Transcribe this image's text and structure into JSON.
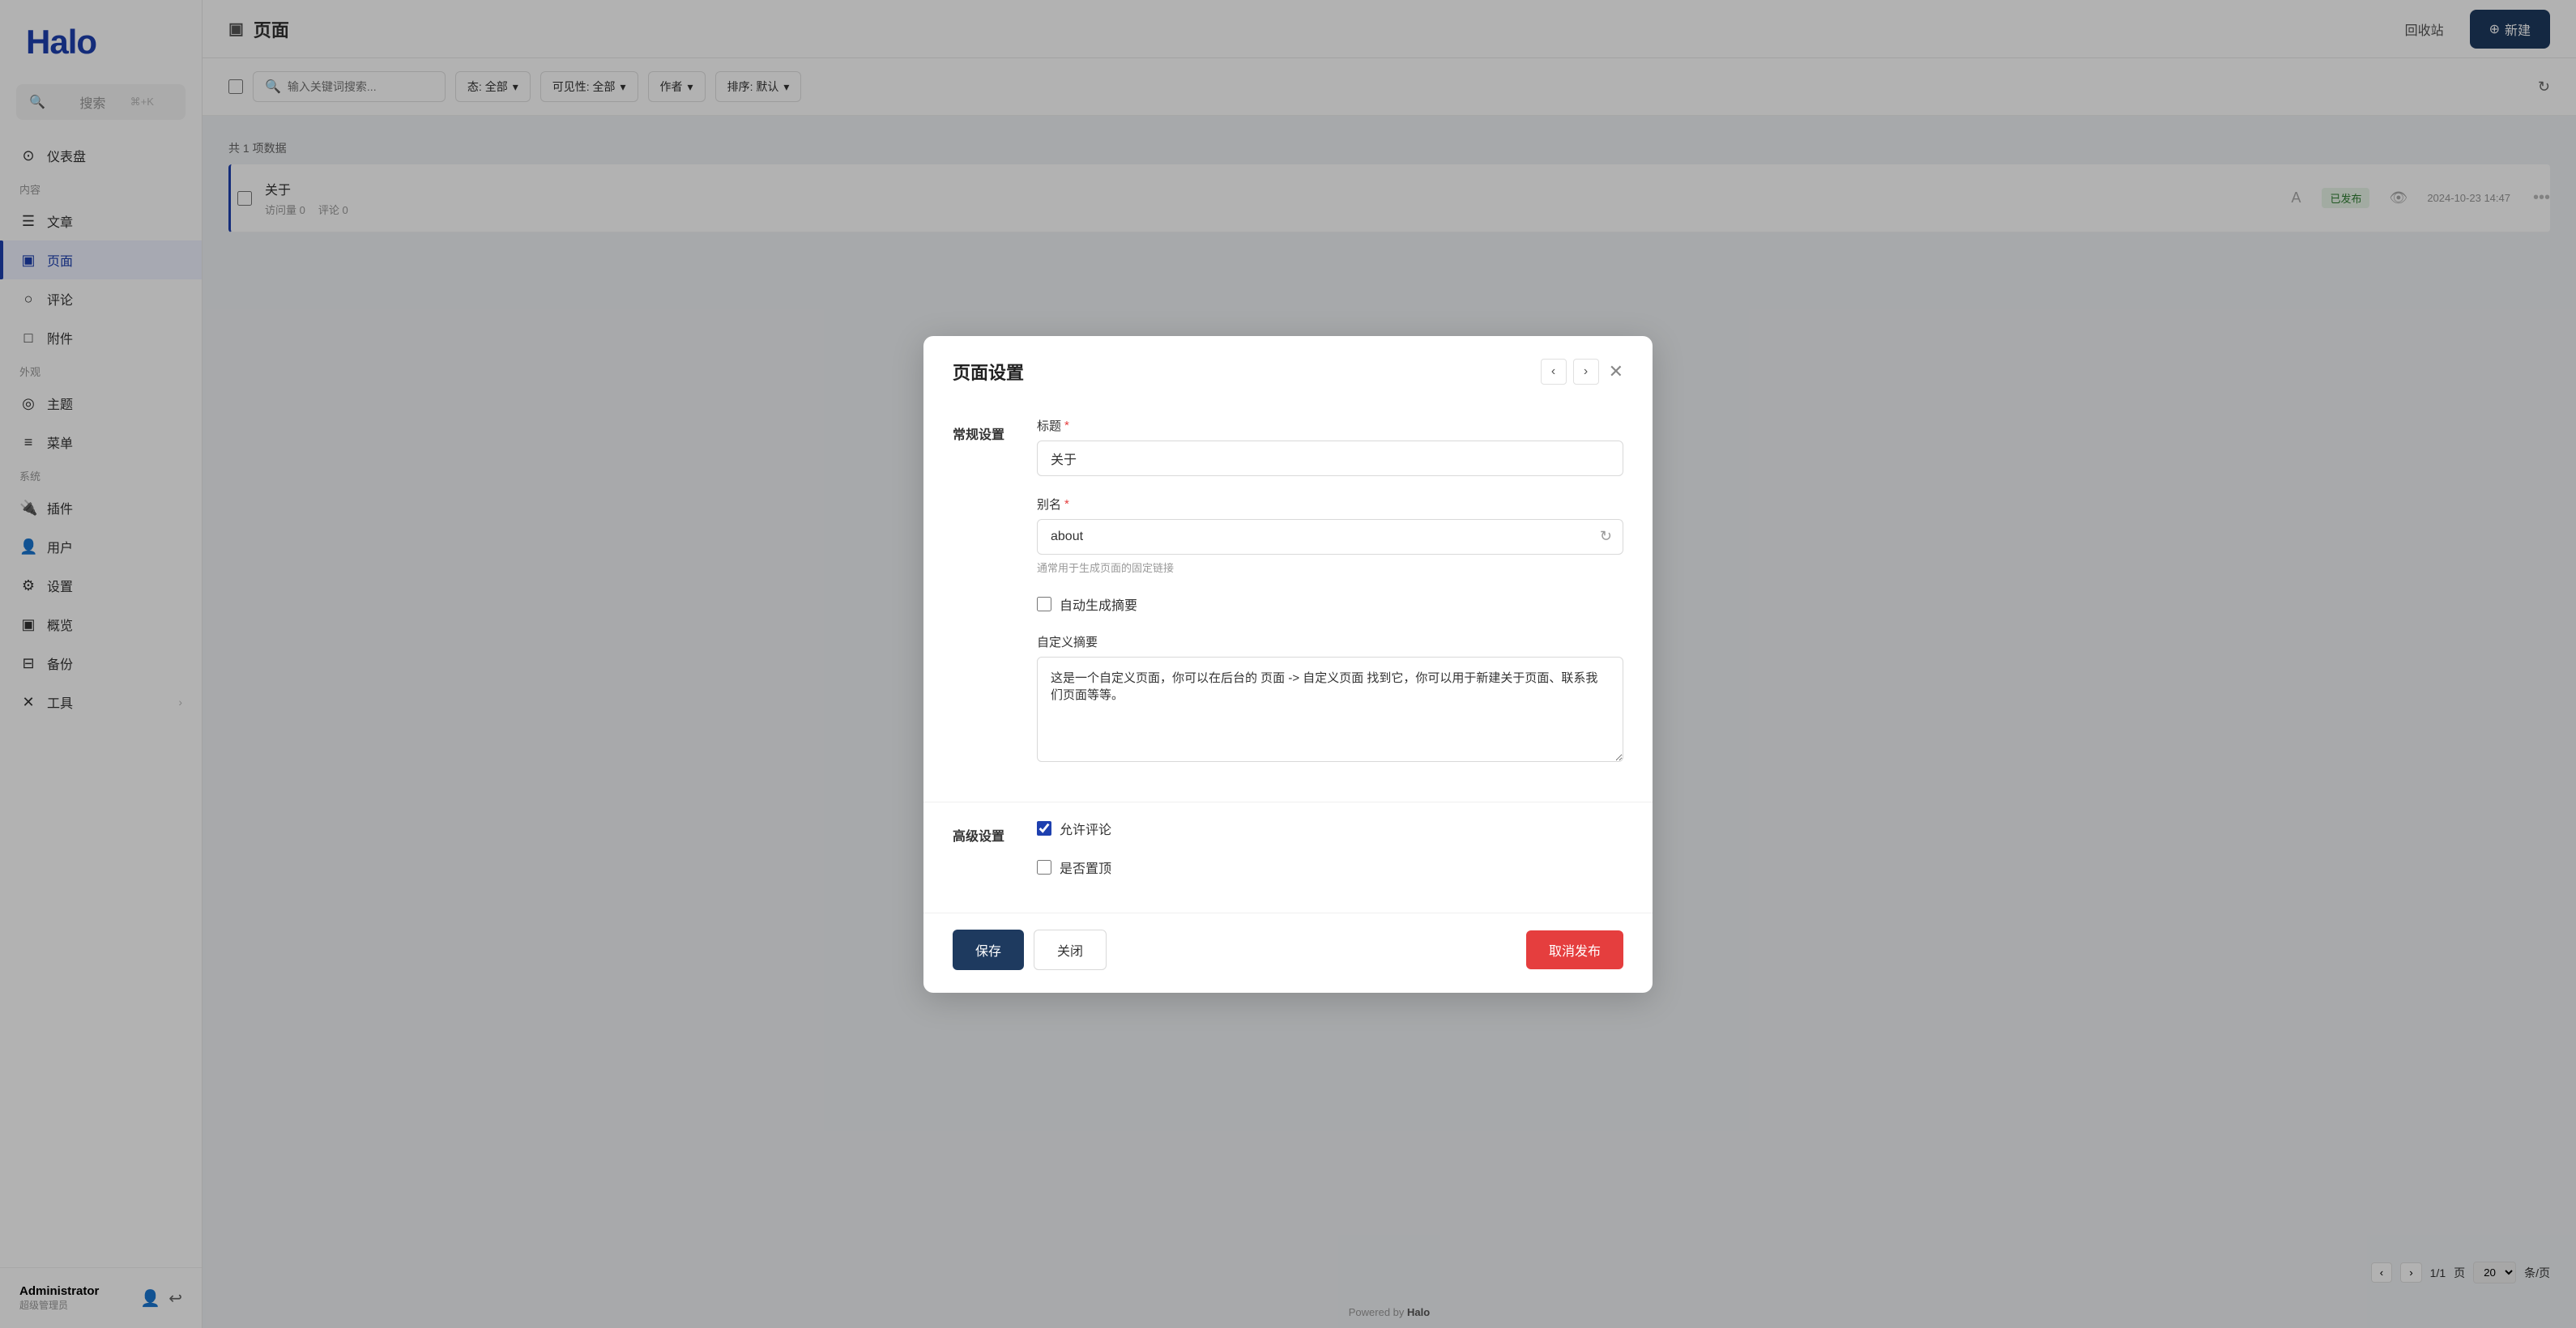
{
  "app": {
    "logo": "Halo"
  },
  "sidebar": {
    "search_placeholder": "搜索",
    "search_shortcut": "⌘+K",
    "sections": [
      {
        "label": "",
        "items": [
          {
            "id": "dashboard",
            "icon": "⊙",
            "label": "仪表盘",
            "active": false
          }
        ]
      },
      {
        "label": "内容",
        "items": [
          {
            "id": "articles",
            "icon": "☰",
            "label": "文章",
            "active": false
          },
          {
            "id": "pages",
            "icon": "▣",
            "label": "页面",
            "active": true
          },
          {
            "id": "comments",
            "icon": "○",
            "label": "评论",
            "active": false
          },
          {
            "id": "attachments",
            "icon": "□",
            "label": "附件",
            "active": false
          }
        ]
      },
      {
        "label": "外观",
        "items": [
          {
            "id": "themes",
            "icon": "◎",
            "label": "主题",
            "active": false
          },
          {
            "id": "menus",
            "icon": "≡",
            "label": "菜单",
            "active": false
          }
        ]
      },
      {
        "label": "系统",
        "items": [
          {
            "id": "plugins",
            "icon": "⚙",
            "label": "插件",
            "active": false
          },
          {
            "id": "users",
            "icon": "👤",
            "label": "用户",
            "active": false
          },
          {
            "id": "settings",
            "icon": "⚙",
            "label": "设置",
            "active": false
          },
          {
            "id": "overview",
            "icon": "▣",
            "label": "概览",
            "active": false
          },
          {
            "id": "backup",
            "icon": "⊟",
            "label": "备份",
            "active": false
          },
          {
            "id": "tools",
            "icon": "✕",
            "label": "工具",
            "active": false
          }
        ]
      }
    ],
    "user": {
      "name": "Administrator",
      "role": "超级管理员"
    }
  },
  "header": {
    "page_icon": "▣",
    "page_title": "页面",
    "recycle_label": "回收站",
    "new_label": "新建"
  },
  "filter_bar": {
    "search_placeholder": "输入关键词搜索...",
    "status_label": "态: 全部",
    "visibility_label": "可见性: 全部",
    "author_label": "作者",
    "sort_label": "排序: 默认"
  },
  "table": {
    "data_count": "共 1 项数据",
    "rows": [
      {
        "id": "1",
        "title": "关于",
        "visits": "访问量 0",
        "comments": "评论 0",
        "status": "已发布",
        "date": "2024-10-23 14:47",
        "active": true
      }
    ]
  },
  "pagination": {
    "prev": "‹",
    "next": "›",
    "current": "1/1",
    "per_page": "20",
    "per_page_suffix": "条/页"
  },
  "footer": {
    "powered_by_text": "Powered by",
    "powered_by_brand": "Halo"
  },
  "modal": {
    "title": "页面设置",
    "section_general": "常规设置",
    "section_advanced": "高级设置",
    "fields": {
      "title_label": "标题",
      "title_required": "*",
      "title_value": "关于",
      "alias_label": "别名",
      "alias_required": "*",
      "alias_value": "about",
      "alias_hint": "通常用于生成页面的固定链接",
      "auto_excerpt_label": "自动生成摘要",
      "auto_excerpt_checked": false,
      "custom_excerpt_label": "自定义摘要",
      "custom_excerpt_value": "这是一个自定义页面，你可以在后台的 页面 -> 自定义页面 找到它，你可以用于新建关于页面、联系我们页面等等。",
      "allow_comment_label": "允许评论",
      "allow_comment_checked": true,
      "pin_top_label": "是否置顶",
      "pin_top_checked": false
    },
    "buttons": {
      "save": "保存",
      "close": "关闭",
      "unpublish": "取消发布"
    }
  }
}
